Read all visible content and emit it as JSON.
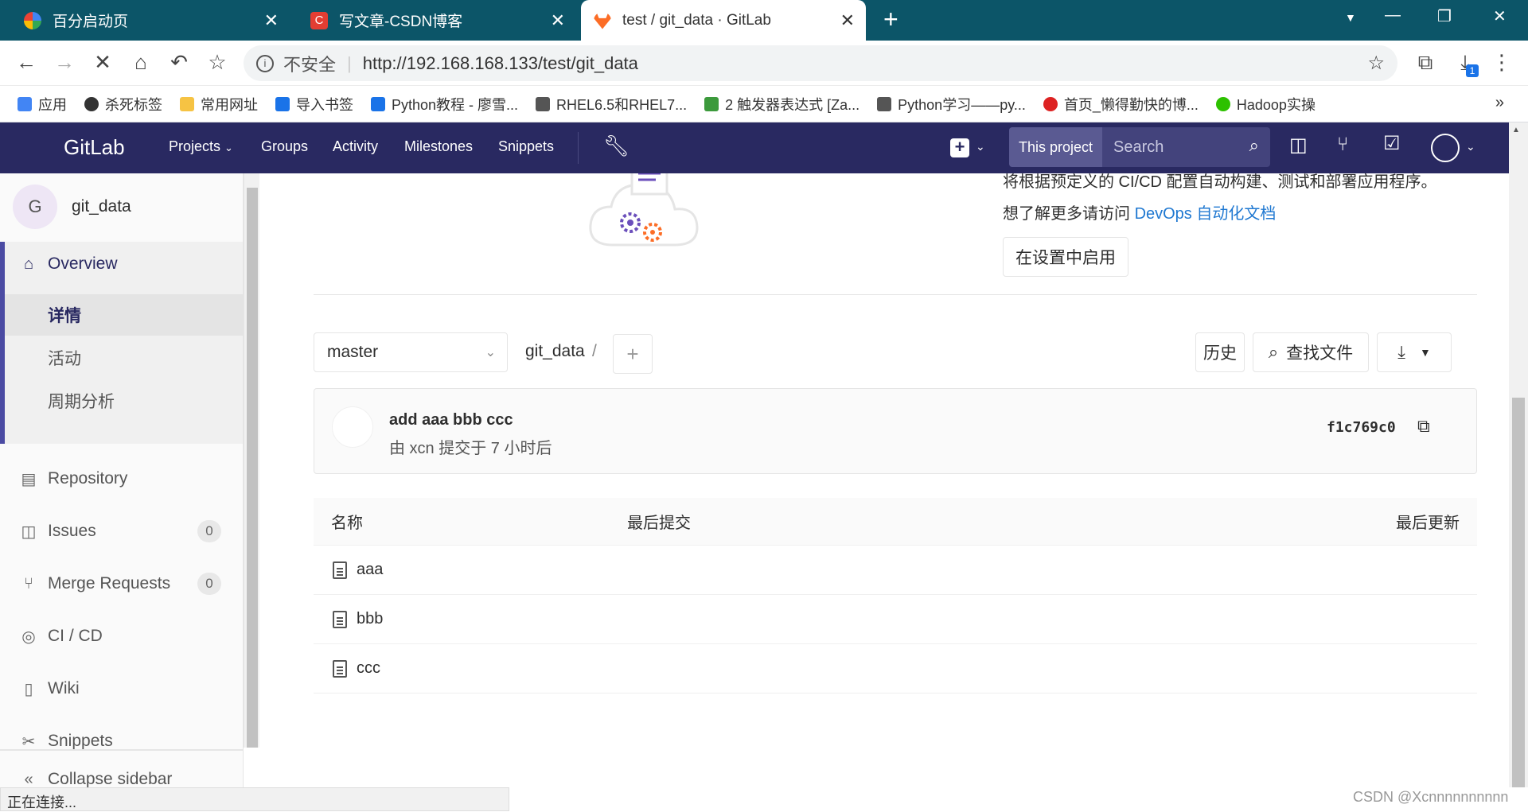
{
  "browser": {
    "tabs": [
      {
        "title": "百分启动页",
        "favicon": "google-icon"
      },
      {
        "title": "写文章-CSDN博客",
        "favicon": "csdn-icon"
      },
      {
        "title": "test / git_data · GitLab",
        "favicon": "gitlab-icon",
        "active": true
      }
    ],
    "new_tab": "+",
    "security_label": "不安全",
    "url": "http://192.168.168.133/test/git_data",
    "download_badge": "1",
    "bookmarks": [
      {
        "label": "应用",
        "icon": "apps-icon"
      },
      {
        "label": "杀死标签",
        "icon": "globe-icon"
      },
      {
        "label": "常用网址",
        "icon": "folder-icon"
      },
      {
        "label": "导入书签",
        "icon": "gear-icon"
      },
      {
        "label": "Python教程 - 廖雪...",
        "icon": "rocket-icon"
      },
      {
        "label": "RHEL6.5和RHEL7...",
        "icon": "link-icon"
      },
      {
        "label": "2 触发器表达式 [Za...",
        "icon": "book-icon"
      },
      {
        "label": "Python学习——py...",
        "icon": "link-icon"
      },
      {
        "label": "首页_懒得勤快的博...",
        "icon": "strawberry-icon"
      },
      {
        "label": "Hadoop实操",
        "icon": "wechat-icon"
      }
    ],
    "bookmarks_overflow": "»",
    "status_text": "正在连接..."
  },
  "gitlab": {
    "logo": "GitLab",
    "nav": [
      "Projects",
      "Groups",
      "Activity",
      "Milestones",
      "Snippets"
    ],
    "search_scope": "This project",
    "search_placeholder": "Search"
  },
  "sidebar": {
    "project_avatar": "G",
    "project_name": "git_data",
    "overview": "Overview",
    "sub_items": [
      "详情",
      "活动",
      "周期分析"
    ],
    "items": [
      {
        "label": "Repository",
        "icon": "repository-icon"
      },
      {
        "label": "Issues",
        "icon": "issues-icon",
        "count": "0"
      },
      {
        "label": "Merge Requests",
        "icon": "merge-request-icon",
        "count": "0"
      },
      {
        "label": "CI / CD",
        "icon": "rocket-icon"
      },
      {
        "label": "Wiki",
        "icon": "book-icon"
      },
      {
        "label": "Snippets",
        "icon": "scissors-icon"
      }
    ],
    "collapse": "Collapse sidebar"
  },
  "autodevops": {
    "text1": "将根据预定义的 CI/CD 配置自动构建、测试和部署应用程序。",
    "text2_prefix": "想了解更多请访问 ",
    "text2_link": "DevOps 自动化文档",
    "button": "在设置中启用"
  },
  "repo": {
    "branch": "master",
    "path": "git_data",
    "path_sep": "/",
    "history_btn": "历史",
    "find_file_btn": "查找文件"
  },
  "commit": {
    "message": "add aaa bbb ccc",
    "meta": "由 xcn 提交于 7 小时后",
    "sha": "f1c769c0"
  },
  "table": {
    "headers": [
      "名称",
      "最后提交",
      "最后更新"
    ],
    "files": [
      "aaa",
      "bbb",
      "ccc"
    ]
  },
  "watermark": "CSDN @Xcnnnnnnnnnn",
  "colors": {
    "nav": "#292961",
    "link": "#1f78d1",
    "tabstrip": "#0c5568"
  }
}
